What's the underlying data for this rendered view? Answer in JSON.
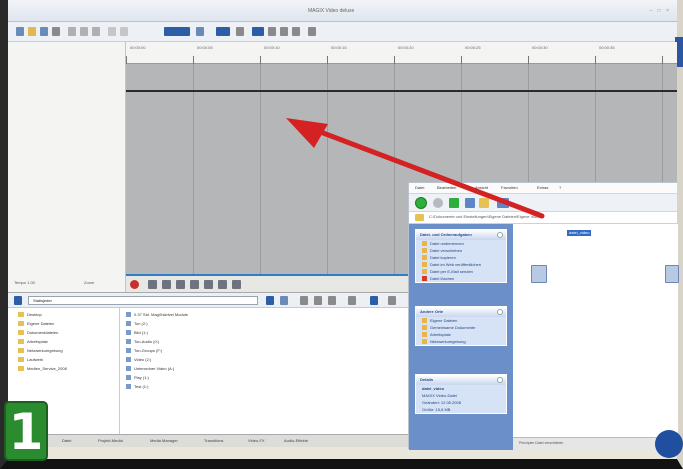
{
  "badge": {
    "number": "1"
  },
  "window": {
    "title": "MAGIX Video deluxe",
    "controls": "– □ ×"
  },
  "left_panel": {
    "time_label": "Tempo 1.00",
    "zoom_label": "Zoom"
  },
  "timeline": {
    "ruler_labels": [
      "00:00:00",
      "00:00:05",
      "00:00:10",
      "00:00:15",
      "00:00:20",
      "00:00:25",
      "00:00:30",
      "00:00:35"
    ]
  },
  "media_browser": {
    "path": "Statisjeder",
    "tree_items": [
      "Desktop",
      "Eigene Dateien",
      "Dokumentdateien",
      "Arbeitsplatz",
      "Netzwerkumgebung",
      "Laufwerk",
      "Medien_Service_2008"
    ],
    "file_items": [
      "0.37 Std. MagiXskrivel Module",
      "Ton (2:)",
      "Bild (1:)",
      "Ton-Audio (0:)",
      "Ton-Groups (F:)",
      "Video (2:)",
      "Unterordner Video (A:)",
      "Play (1:)",
      "Test (1:)"
    ]
  },
  "bottom_tabs": [
    "Datei",
    "Projekt-Media",
    "Media Manager",
    "Transitions",
    "Video-FX",
    "Audio-Effekte"
  ],
  "explorer": {
    "menu": [
      "Datei",
      "Bearbeiten",
      "Ansicht",
      "Favoriten",
      "Extras",
      "?"
    ],
    "address": "C:\\Dokumente und Einstellungen\\Eigene Dateien\\Eigene Videos",
    "task_box_1": {
      "title": "Datei- und Ordneraufgaben",
      "items": [
        "Datei umbenennen",
        "Datei verschieben",
        "Datei kopieren",
        "Datei im Web veröffentlichen",
        "Datei per E-Mail senden",
        "Datei löschen"
      ]
    },
    "task_box_2": {
      "title": "Andere Orte",
      "items": [
        "Eigene Dateien",
        "Gemeinsame Dokumente",
        "Arbeitsplatz",
        "Netzwerkumgebung"
      ]
    },
    "task_box_3": {
      "title": "Details",
      "lines": [
        "datei_video",
        "MAGIX Video-Datei",
        "Geändert: 12.05.2008",
        "Größe: 15,6 MB"
      ]
    },
    "selected_file": "datei_video",
    "status": "Prinzipien Datei verschieben"
  }
}
